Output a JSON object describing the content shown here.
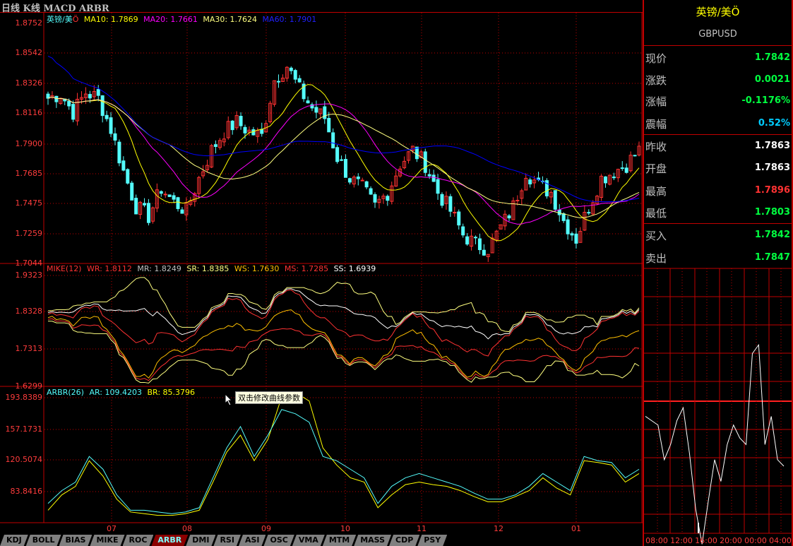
{
  "header": {
    "title": "日线 K线 MACD ARBR"
  },
  "colors": {
    "up": "#ff3232",
    "down": "#54fcfc",
    "ma10": "#ffff00",
    "ma20": "#ff00ff",
    "ma30": "#ffff80",
    "ma60": "#0000ff",
    "grid": "#c00000"
  },
  "price_panel": {
    "legend": {
      "name": "英镑/美",
      "mark": "Ö",
      "ma10": "MA10: 1.7869",
      "ma20": "MA20: 1.7661",
      "ma30": "MA30: 1.7624",
      "ma60": "MA60: 1.7901"
    },
    "yticks": [
      "1.8752",
      "1.8542",
      "1.8326",
      "1.8116",
      "1.7900",
      "1.7685",
      "1.7475",
      "1.7259",
      "1.7044"
    ],
    "ylim": [
      1.7044,
      1.8752
    ],
    "closes": [
      1.822,
      1.825,
      1.812,
      1.826,
      1.822,
      1.8,
      1.77,
      1.745,
      1.738,
      1.758,
      1.748,
      1.742,
      1.765,
      1.785,
      1.798,
      1.805,
      1.798,
      1.795,
      1.835,
      1.845,
      1.828,
      1.815,
      1.808,
      1.78,
      1.765,
      1.758,
      1.745,
      1.755,
      1.775,
      1.785,
      1.775,
      1.755,
      1.742,
      1.725,
      1.718,
      1.715,
      1.73,
      1.745,
      1.77,
      1.76,
      1.755,
      1.735,
      1.722,
      1.745,
      1.765,
      1.77,
      1.775,
      1.785
    ]
  },
  "mike_panel": {
    "legend": {
      "name": "MIKE(12)",
      "wr": "WR: 1.8112",
      "mr": "MR: 1.8249",
      "sr": "SR: 1.8385",
      "ws": "WS: 1.7630",
      "ms": "MS: 1.7285",
      "ss": "SS: 1.6939"
    },
    "yticks": [
      "1.9323",
      "1.8328",
      "1.7313",
      "1.6299"
    ],
    "ylim": [
      1.6299,
      1.9323
    ]
  },
  "arbr_panel": {
    "legend": {
      "name": "ARBR(26)",
      "ar": "AR: 109.4203",
      "br": "BR: 85.3796"
    },
    "yticks": [
      "193.8389",
      "157.1731",
      "120.5074",
      "83.8416"
    ],
    "ylim": [
      50,
      193.8389
    ],
    "ar": [
      70,
      85,
      95,
      125,
      110,
      80,
      62,
      62,
      60,
      58,
      60,
      65,
      100,
      135,
      160,
      125,
      150,
      180,
      175,
      165,
      125,
      120,
      110,
      100,
      70,
      90,
      100,
      105,
      100,
      95,
      90,
      82,
      75,
      75,
      80,
      90,
      105,
      95,
      85,
      125,
      120,
      118,
      100,
      110
    ],
    "br": [
      62,
      80,
      90,
      120,
      102,
      75,
      60,
      58,
      56,
      56,
      58,
      62,
      95,
      130,
      150,
      120,
      145,
      195,
      200,
      190,
      135,
      115,
      100,
      95,
      65,
      80,
      92,
      95,
      92,
      90,
      85,
      78,
      72,
      72,
      78,
      85,
      100,
      88,
      80,
      120,
      118,
      115,
      95,
      105
    ]
  },
  "xaxis": {
    "months": [
      "07",
      "08",
      "09",
      "10",
      "11",
      "12",
      "01"
    ]
  },
  "tooltip": "双击修改曲线参数",
  "tabs": [
    {
      "label": "KDJ"
    },
    {
      "label": "BOLL"
    },
    {
      "label": "BIAS"
    },
    {
      "label": "MIKE"
    },
    {
      "label": "ROC"
    },
    {
      "label": "ARBR",
      "active": true
    },
    {
      "label": "DMI"
    },
    {
      "label": "RSI"
    },
    {
      "label": "ASI"
    },
    {
      "label": "OSC"
    },
    {
      "label": "VMA"
    },
    {
      "label": "MTM"
    },
    {
      "label": "MASS"
    },
    {
      "label": "CDP"
    },
    {
      "label": "PSY"
    }
  ],
  "quote": {
    "name": "英镑/美Ö",
    "code": "GBPUSD",
    "rows": [
      {
        "label": "现价",
        "value": "1.7842",
        "color": "#00ff40"
      },
      {
        "label": "涨跌",
        "value": "0.0021",
        "color": "#00ff40"
      },
      {
        "label": "涨幅",
        "value": "-0.1176%",
        "color": "#00ff40"
      },
      {
        "label": "震幅",
        "value": "0.52%",
        "color": "#00ccff"
      },
      {
        "label": "昨收",
        "value": "1.7863",
        "color": "#ffffff"
      },
      {
        "label": "开盘",
        "value": "1.7863",
        "color": "#ffffff"
      },
      {
        "label": "最高",
        "value": "1.7896",
        "color": "#ff3232"
      },
      {
        "label": "最低",
        "value": "1.7803",
        "color": "#00ff40"
      },
      {
        "label": "买入",
        "value": "1.7842",
        "color": "#00ff40"
      },
      {
        "label": "卖出",
        "value": "1.7847",
        "color": "#00ff40"
      }
    ]
  },
  "intraday": {
    "prev_close": 1.7863,
    "prices": [
      1.7856,
      1.7854,
      1.7852,
      1.7836,
      1.7843,
      1.7854,
      1.786,
      1.7839,
      1.7813,
      1.7797,
      1.7817,
      1.7836,
      1.7826,
      1.7843,
      1.7852,
      1.7846,
      1.7843,
      1.7885,
      1.7889,
      1.7843,
      1.7856,
      1.7836,
      1.7833
    ],
    "times": [
      "08:00",
      "12:00",
      "16:00",
      "20:00",
      "00:00",
      "04:00"
    ]
  }
}
